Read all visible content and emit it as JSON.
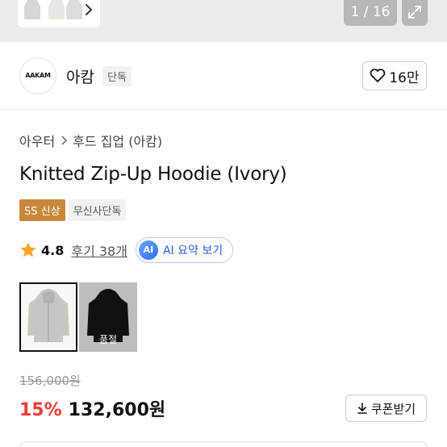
{
  "gallery": {
    "counter": "1 / 16",
    "expand_icon": "expand-icon",
    "next_icon": "chevron-right-icon"
  },
  "brand": {
    "logo_text": "AAKAM",
    "name": "아캄",
    "badge": "단독",
    "like_count": "16만",
    "like_icon": "heart-icon"
  },
  "breadcrumb": {
    "items": [
      "아우터",
      "후드 집업 (아캄)"
    ],
    "separator_icon": "chevron-right-icon"
  },
  "product": {
    "title": "Knitted Zip-Up Hoodie (Ivory)",
    "tags": [
      "SS 신상",
      "무신사단독"
    ],
    "rating": "4.8",
    "review_link": "후기 38개",
    "ai_icon_text": "AI",
    "ai_summary_label": "AI 요약 보기"
  },
  "options": {
    "soldout_label": "품절"
  },
  "price": {
    "original": "156,000원",
    "discount": "15%",
    "sale": "132,600원",
    "coupon_label": "쿠폰받기",
    "coupon_icon": "download-icon"
  },
  "colors": {
    "discount": "#ee3a36",
    "season_tag": "#c8883c",
    "ai_accent": "#2d5bd8"
  }
}
